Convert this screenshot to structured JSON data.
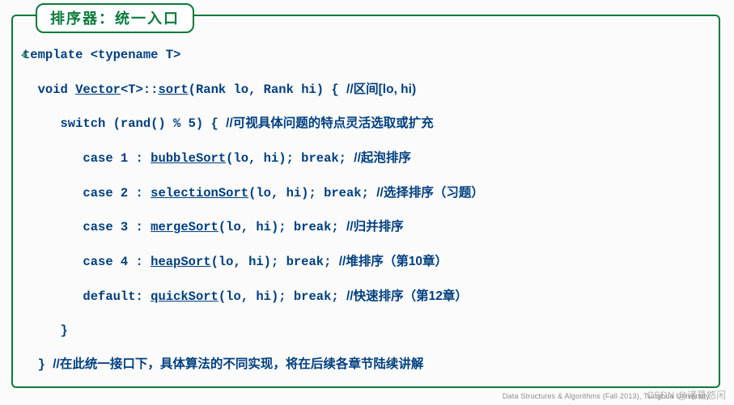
{
  "title": "排序器：统一入口",
  "code": {
    "l1_a": "template <typename T>",
    "l2_a": "  void ",
    "l2_b": "Vector",
    "l2_c": "<T>::",
    "l2_d": "sort",
    "l2_e": "(Rank lo, Rank hi) { ",
    "l2_f": "//区间[lo, hi)",
    "l3_a": "     switch (rand() % 5) { ",
    "l3_b": "//可视具体问题的特点灵活选取或扩充",
    "l4_a": "        case 1 : ",
    "l4_b": "bubbleSort",
    "l4_c": "(lo, hi); break; ",
    "l4_d": "//起泡排序",
    "l5_a": "        case 2 : ",
    "l5_b": "selectionSort",
    "l5_c": "(lo, hi); break; ",
    "l5_d": "//选择排序（习题）",
    "l6_a": "        case 3 : ",
    "l6_b": "mergeSort",
    "l6_c": "(lo, hi); break; ",
    "l6_d": "//归并排序",
    "l7_a": "        case 4 : ",
    "l7_b": "heapSort",
    "l7_c": "(lo, hi); break; ",
    "l7_d": "//堆排序（第10章）",
    "l8_a": "        default: ",
    "l8_b": "quickSort",
    "l8_c": "(lo, hi); break; ",
    "l8_d": "//快速排序（第12章）",
    "l9": "     }",
    "l10_a": "  } ",
    "l10_b": "//在此统一接口下，具体算法的不同实现，将在后续各章节陆续讲解"
  },
  "footer": "Data Structures & Algorithms (Fall 2013), Tsinghua University",
  "watermark": "CSDN @诸葛悠闲"
}
